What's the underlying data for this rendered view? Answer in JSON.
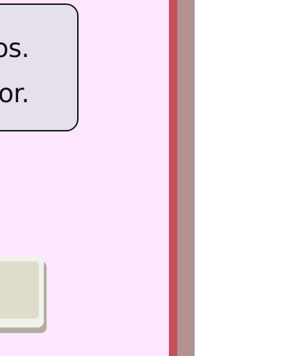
{
  "speech_bubble": {
    "line_1": "pos.",
    "line_2": "nor."
  }
}
